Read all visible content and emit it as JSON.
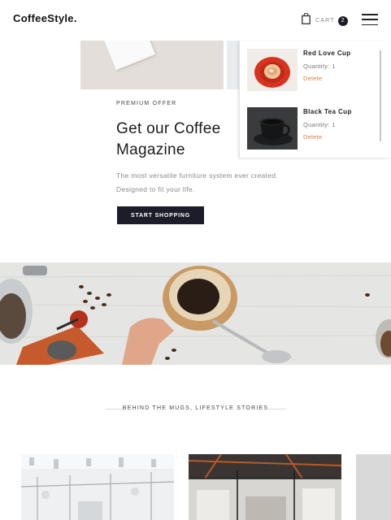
{
  "header": {
    "logo": "CoffeeStyle.",
    "cart_label": "CART",
    "cart_count": "2"
  },
  "hero": {
    "offer_label": "PREMIUM OFFER",
    "headline": "Get our Coffee Magazine",
    "description": "The most versatile furniture system ever created. Designed to fit your life.",
    "button_label": "START SHOPPING"
  },
  "cart_dropdown": {
    "items": [
      {
        "name": "Red Love Cup",
        "quantity": "Quantity: 1",
        "delete_label": "Delete"
      },
      {
        "name": "Black Tea Cup",
        "quantity": "Quantity: 1",
        "delete_label": "Delete"
      }
    ]
  },
  "stories": {
    "label": "BEHIND THE MUGS, LIFESTYLE STORIES"
  },
  "colors": {
    "button_bg": "#1c1c2b",
    "delete_link": "#d97a3c",
    "cart_badge": "#1c1c28"
  },
  "icons": [
    "shopping-bag-icon",
    "hamburger-menu-icon"
  ]
}
